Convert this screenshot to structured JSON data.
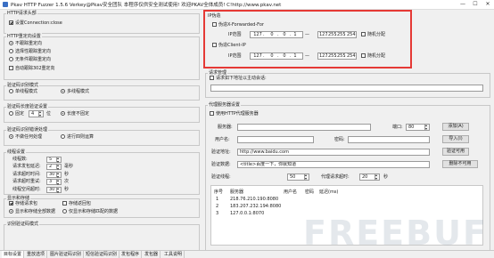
{
  "window": {
    "title": "Pkav HTTP Fuzzer 1.5.6  Verkey@Pkav安全团队  本程序仅供安全测试使用!  欢迎PKAV全体成员!  C!http://www.pkav.net",
    "minimize": "—",
    "maximize": "☐",
    "close": "✕"
  },
  "http_header": {
    "label": "HTTP请求头部",
    "set_conn_close": "设置Connection:close"
  },
  "redirect": {
    "label": "HTTP重定向设置",
    "opt1": "不跟踪重定向",
    "opt2": "选择性跟踪重定向",
    "opt3": "无条件跟踪重定向",
    "opt4": "自动跟踪302重定向"
  },
  "captcha_mode": {
    "label": "验证码识别模式",
    "single": "单线程模式",
    "multi": "多线程模式"
  },
  "captcha_len": {
    "label": "验证码长度验证设置",
    "fixed": "固定",
    "value": "4",
    "unit": "位",
    "unfixed": "长度不固定"
  },
  "captcha_fail": {
    "label": "验证码识别错误处理",
    "no_process": "不做任何处理",
    "retry": "进行四则运算"
  },
  "threads": {
    "label": "线程设置",
    "rows": [
      {
        "name": "线程数:",
        "value": "5",
        "unit": ""
      },
      {
        "name": "请求发包延迟:",
        "value": "2",
        "unit": "毫秒"
      },
      {
        "name": "请求超时时间:",
        "value": "30",
        "unit": "秒"
      },
      {
        "name": "请求超时重试:",
        "value": "3",
        "unit": "次"
      },
      {
        "name": "线程空闲超时:",
        "value": "30",
        "unit": "秒"
      }
    ]
  },
  "display": {
    "label": "显示和存储",
    "save_req": "存储请求包",
    "save_resp": "存储返回包",
    "show_resp_len": "显示和存储全部数据",
    "show_only": "仅显示和存储匹配的数据"
  },
  "captcha_misc": {
    "label": "识别验证码模式"
  },
  "bottom_tabs": [
    "目标设置",
    "重放选项",
    "图片验证码识别",
    "短信验证码识别",
    "发包程序",
    "发包器",
    "工具说明"
  ],
  "ip_forge": {
    "label": "IP伪造",
    "xff": "伪造X-Forwarded-For",
    "xff_range": "IP范围",
    "xff_start": [
      "127",
      "0",
      "0",
      "1"
    ],
    "xff_end": [
      "127",
      "255",
      "255",
      "254"
    ],
    "xff_random": "随机分配",
    "cip": "伪造Client-IP",
    "cip_range": "IP范围",
    "cip_start": [
      "127",
      "0",
      "0",
      "1"
    ],
    "cip_end": [
      "127",
      "255",
      "255",
      "254"
    ],
    "cip_random": "随机分配"
  },
  "resp_check": {
    "label": "请求管理",
    "no_match": "请求如下地址以主动会话:"
  },
  "proxy": {
    "label": "代理服务器设置",
    "use_proxy": "使用HTTP代理服务器",
    "server_label": "服务器:",
    "port_label": "端口:",
    "port_value": "80",
    "add_btn": "添加(A)",
    "user_label": "用户名:",
    "pass_label": "密码:",
    "import_btn": "导入(I)",
    "verify_url_label": "验证地址:",
    "verify_url": "http://www.baidu.com",
    "verify_btn": "验证可用",
    "verify_data_label": "验证数据:",
    "verify_data": "<title>百度一下，你就知道",
    "remove_btn": "删除不可用",
    "threads_label": "验证线程:",
    "threads_value": "50",
    "timeout_label": "代理请求超时:",
    "timeout_value": "20",
    "timeout_unit": "秒",
    "cols": [
      "序号",
      "服务器",
      "用户名",
      "密码",
      "延迟(ms)"
    ],
    "rows": [
      {
        "n": "1",
        "server": "218.76.210.190:8080"
      },
      {
        "n": "2",
        "server": "183.207.232.194:8080"
      },
      {
        "n": "3",
        "server": "127.0.0.1:8070"
      }
    ]
  },
  "watermark": "FREEBUF"
}
